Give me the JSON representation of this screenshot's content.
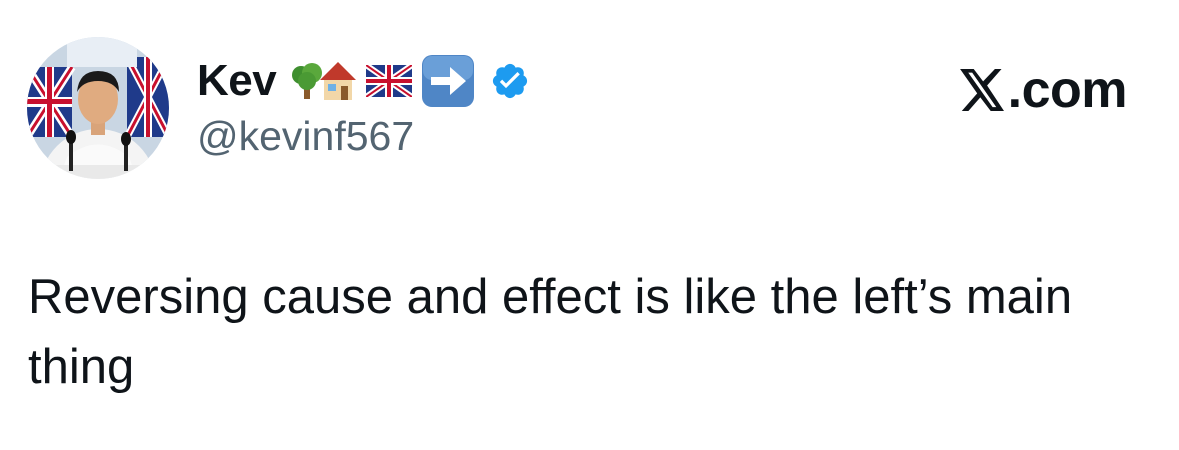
{
  "author": {
    "display_name": "Kev",
    "handle": "@kevinf567",
    "name_emojis": [
      "tree-emoji",
      "house-emoji",
      "uk-flag-emoji",
      "right-arrow-emoji"
    ],
    "verified_badge": "verified-badge-icon",
    "verified_color": "#1d9bf0"
  },
  "brand": {
    "logo": "x-logo-icon",
    "text": ".com"
  },
  "tweet": {
    "text": "Reversing cause and effect is like the left’s main thing"
  },
  "colors": {
    "text_primary": "#0f1419",
    "text_secondary": "#536471",
    "background": "#ffffff"
  }
}
